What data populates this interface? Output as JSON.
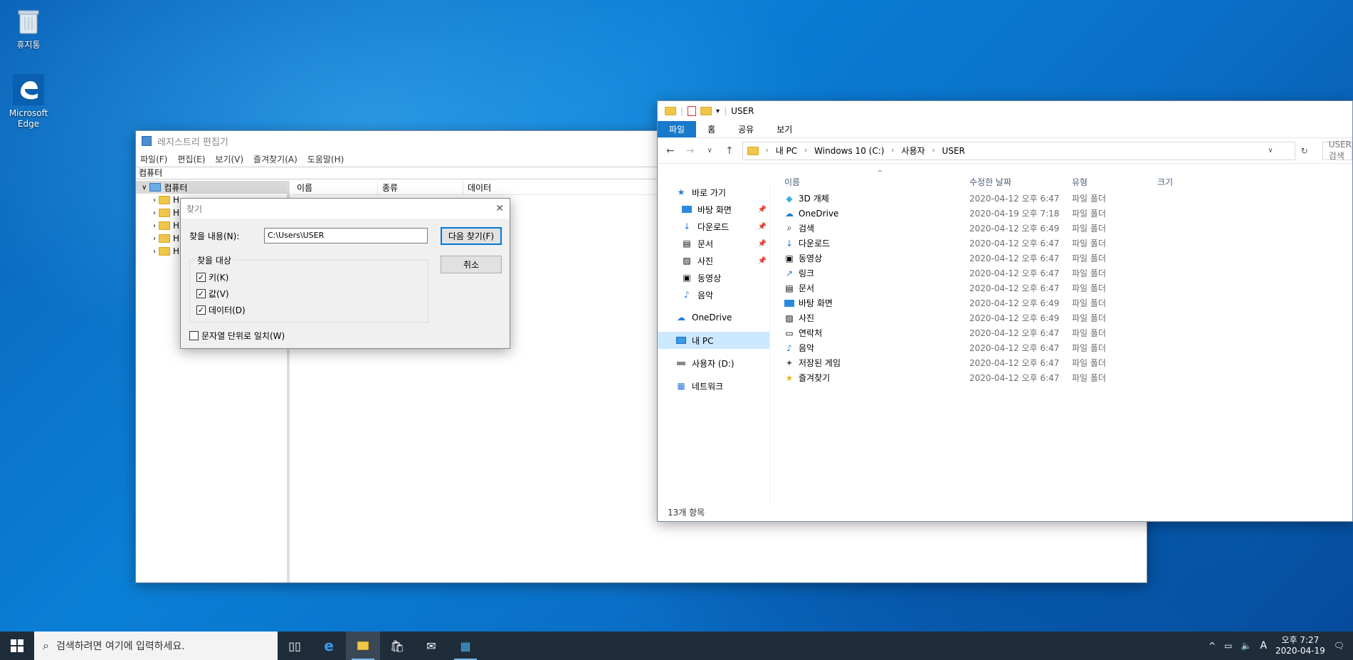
{
  "desktop": {
    "icons": [
      {
        "label": "휴지통",
        "icon": "recycle-bin-icon"
      },
      {
        "label": "Microsoft Edge",
        "icon": "edge-icon"
      }
    ]
  },
  "regedit": {
    "title": "레지스트리 편집기",
    "menu": [
      "파일(F)",
      "편집(E)",
      "보기(V)",
      "즐겨찾기(A)",
      "도움말(H)"
    ],
    "address": "컴퓨터",
    "tree_root": "컴퓨터",
    "tree_children": [
      "H",
      "H",
      "H",
      "H",
      "H"
    ],
    "columns": [
      "이름",
      "종류",
      "데이터"
    ]
  },
  "find_dialog": {
    "title": "찾기",
    "find_label": "찾을 내용(N):",
    "find_value": "C:\\Users\\USER",
    "find_next": "다음 찾기(F)",
    "cancel": "취소",
    "group_label": "찾을 대상",
    "options": [
      {
        "label": "키(K)",
        "checked": true
      },
      {
        "label": "값(V)",
        "checked": true
      },
      {
        "label": "데이터(D)",
        "checked": true
      }
    ],
    "match_whole": {
      "label": "문자열 단위로 일치(W)",
      "checked": false
    }
  },
  "explorer": {
    "title": "USER",
    "ribbon_tabs": [
      "파일",
      "홈",
      "공유",
      "보기"
    ],
    "breadcrumb": [
      "내 PC",
      "Windows 10 (C:)",
      "사용자",
      "USER"
    ],
    "search_placeholder": "USER 검색",
    "nav": [
      {
        "label": "바로 가기",
        "icon": "star-icon",
        "pinned": false
      },
      {
        "label": "바탕 화면",
        "icon": "desktop-icon",
        "pinned": true
      },
      {
        "label": "다운로드",
        "icon": "download-icon",
        "pinned": true
      },
      {
        "label": "문서",
        "icon": "document-icon",
        "pinned": true
      },
      {
        "label": "사진",
        "icon": "picture-icon",
        "pinned": true
      },
      {
        "label": "동영상",
        "icon": "video-icon",
        "pinned": false
      },
      {
        "label": "음악",
        "icon": "music-icon",
        "pinned": false
      },
      {
        "label": "OneDrive",
        "icon": "cloud-icon",
        "pinned": false
      },
      {
        "label": "내 PC",
        "icon": "pc-icon",
        "pinned": false
      },
      {
        "label": "사용자 (D:)",
        "icon": "drive-icon",
        "pinned": false
      },
      {
        "label": "네트워크",
        "icon": "network-icon",
        "pinned": false
      }
    ],
    "columns": [
      "이름",
      "수정한 날짜",
      "유형",
      "크기"
    ],
    "files": [
      {
        "name": "3D 개체",
        "date": "2020-04-12 오후 6:47",
        "type": "파일 폴더",
        "icon": "3d-objects-icon"
      },
      {
        "name": "OneDrive",
        "date": "2020-04-19 오후 7:18",
        "type": "파일 폴더",
        "icon": "cloud-icon"
      },
      {
        "name": "검색",
        "date": "2020-04-12 오후 6:49",
        "type": "파일 폴더",
        "icon": "search-icon"
      },
      {
        "name": "다운로드",
        "date": "2020-04-12 오후 6:47",
        "type": "파일 폴더",
        "icon": "download-icon"
      },
      {
        "name": "동영상",
        "date": "2020-04-12 오후 6:47",
        "type": "파일 폴더",
        "icon": "video-icon"
      },
      {
        "name": "링크",
        "date": "2020-04-12 오후 6:47",
        "type": "파일 폴더",
        "icon": "link-icon"
      },
      {
        "name": "문서",
        "date": "2020-04-12 오후 6:47",
        "type": "파일 폴더",
        "icon": "document-icon"
      },
      {
        "name": "바탕 화면",
        "date": "2020-04-12 오후 6:49",
        "type": "파일 폴더",
        "icon": "desktop-icon"
      },
      {
        "name": "사진",
        "date": "2020-04-12 오후 6:49",
        "type": "파일 폴더",
        "icon": "picture-icon"
      },
      {
        "name": "연락처",
        "date": "2020-04-12 오후 6:47",
        "type": "파일 폴더",
        "icon": "contacts-icon"
      },
      {
        "name": "음악",
        "date": "2020-04-12 오후 6:47",
        "type": "파일 폴더",
        "icon": "music-icon"
      },
      {
        "name": "저장된 게임",
        "date": "2020-04-12 오후 6:47",
        "type": "파일 폴더",
        "icon": "saved-games-icon"
      },
      {
        "name": "즐겨찾기",
        "date": "2020-04-12 오후 6:47",
        "type": "파일 폴더",
        "icon": "favorites-icon"
      }
    ],
    "status": "13개 항목"
  },
  "taskbar": {
    "search_placeholder": "검색하려면 여기에 입력하세요.",
    "ime": "A",
    "time": "오후 7:27",
    "date": "2020-04-19"
  }
}
